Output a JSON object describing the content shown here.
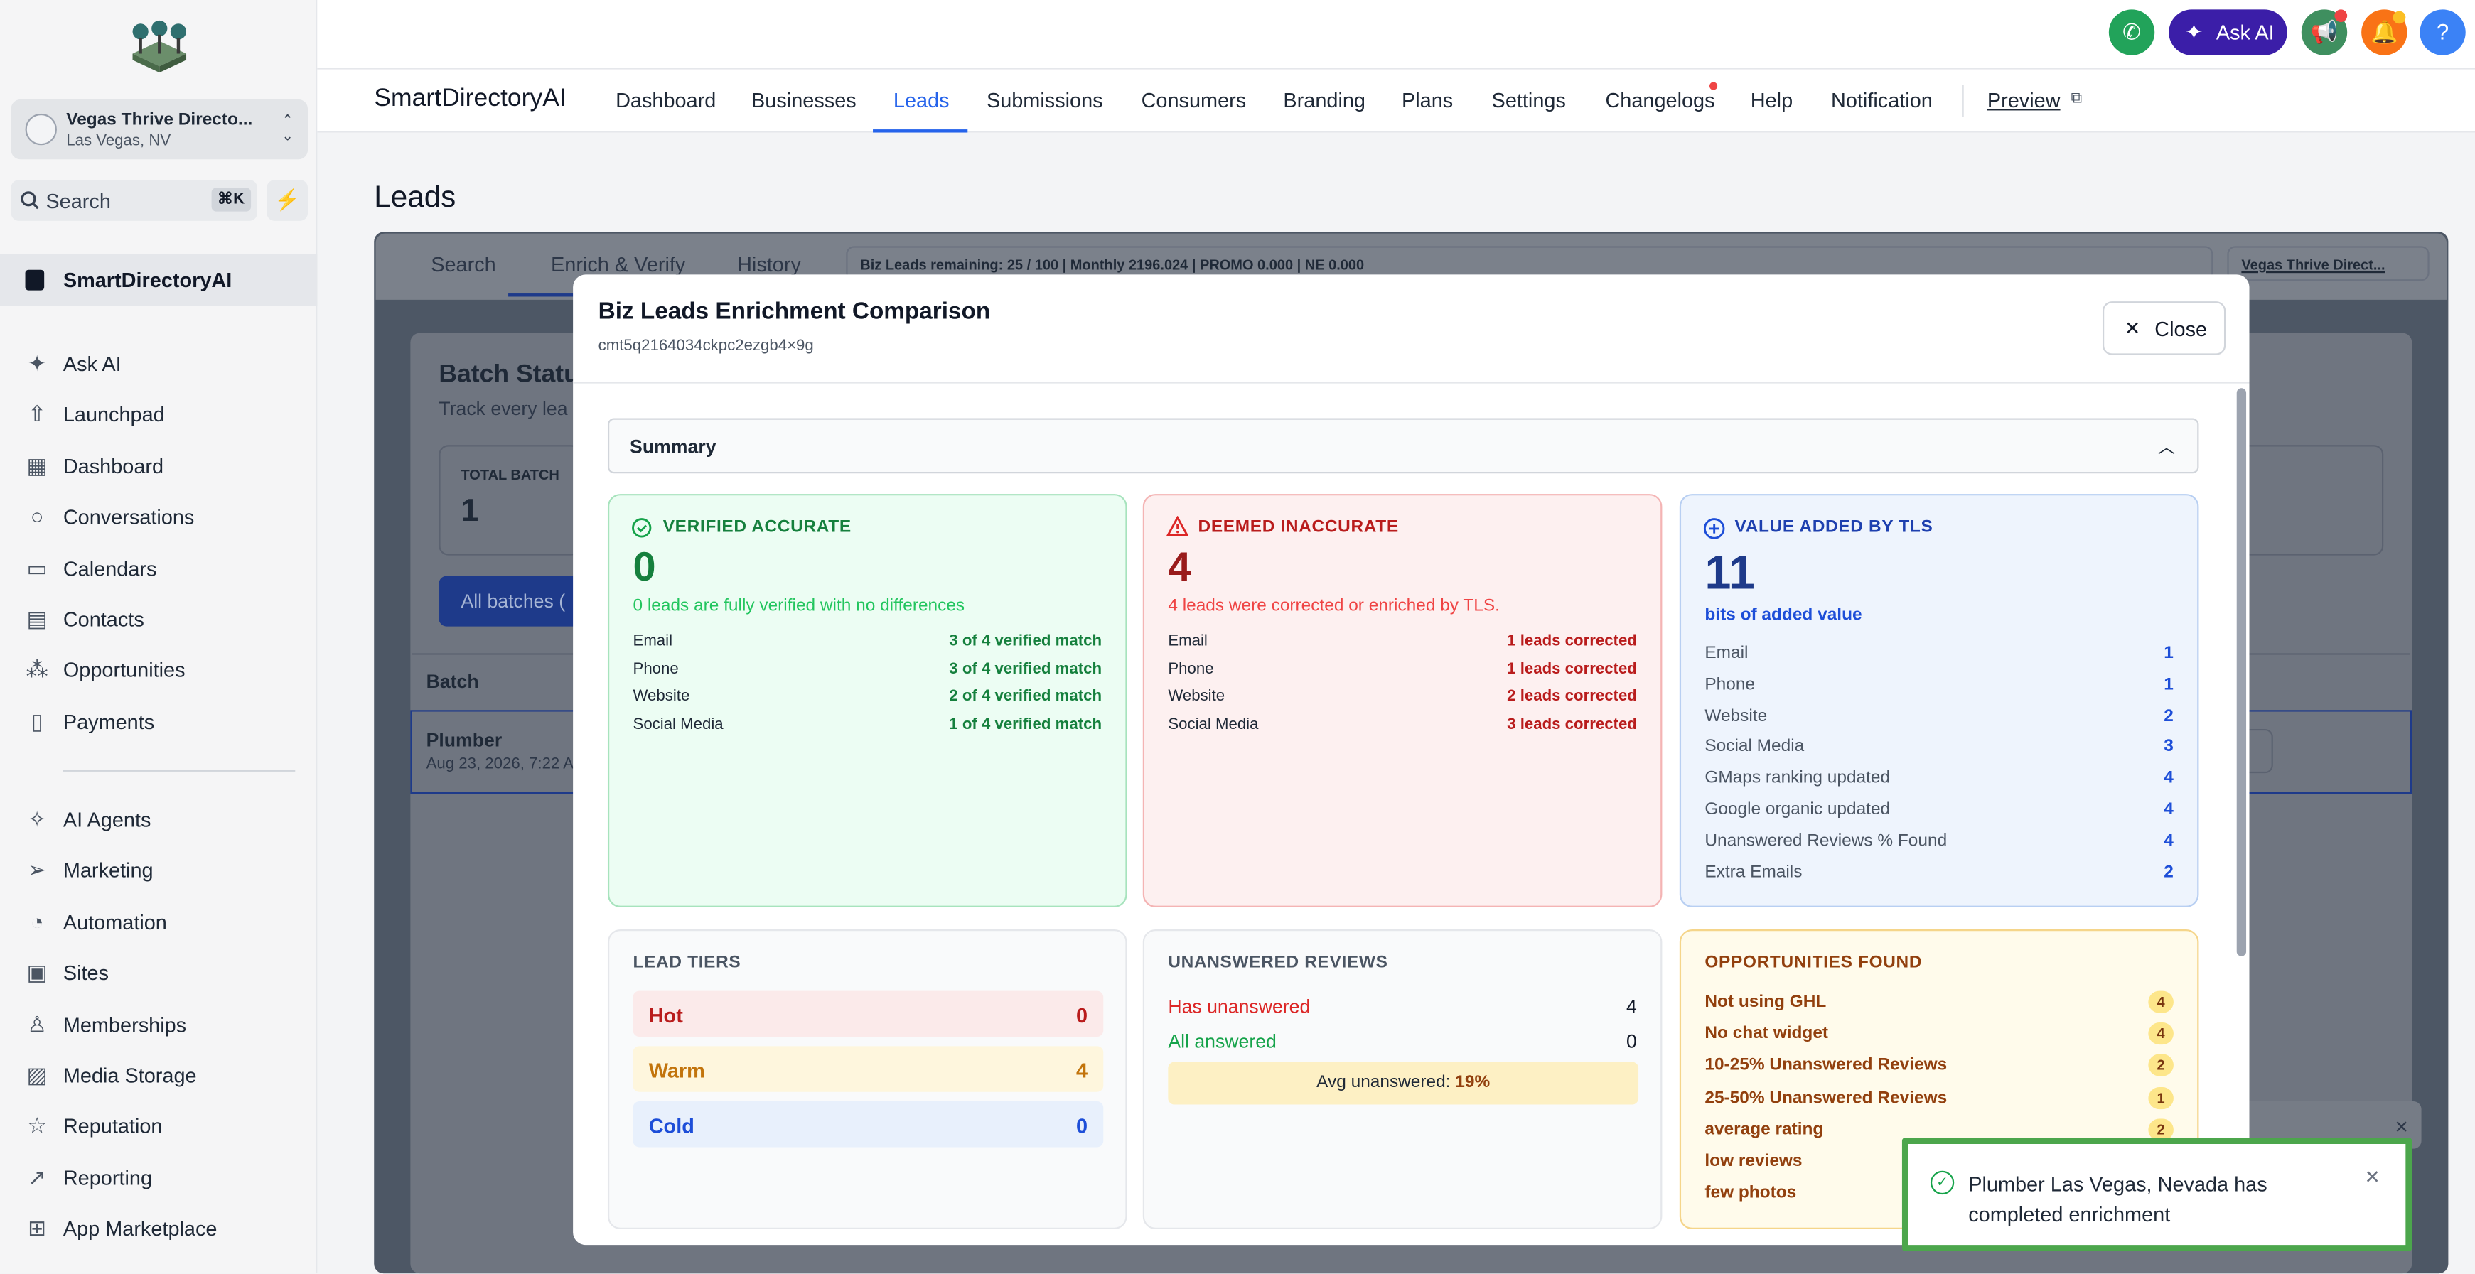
{
  "sidebar": {
    "location_name": "Vegas Thrive Directo...",
    "location_city": "Las Vegas, NV",
    "search_label": "Search",
    "search_shortcut": "⌘K",
    "selected": "SmartDirectoryAI",
    "items": [
      {
        "label": "Ask AI",
        "icon": "sparkle-icon"
      },
      {
        "label": "Launchpad",
        "icon": "rocket-icon"
      },
      {
        "label": "Dashboard",
        "icon": "grid-icon"
      },
      {
        "label": "Conversations",
        "icon": "chat-icon"
      },
      {
        "label": "Calendars",
        "icon": "calendar-icon"
      },
      {
        "label": "Contacts",
        "icon": "contacts-icon"
      },
      {
        "label": "Opportunities",
        "icon": "opportunities-icon"
      },
      {
        "label": "Payments",
        "icon": "payments-icon"
      }
    ],
    "items2": [
      {
        "label": "AI Agents",
        "icon": "ai-agents-icon"
      },
      {
        "label": "Marketing",
        "icon": "send-icon"
      },
      {
        "label": "Automation",
        "icon": "automation-icon"
      },
      {
        "label": "Sites",
        "icon": "sites-icon"
      },
      {
        "label": "Memberships",
        "icon": "memberships-icon"
      },
      {
        "label": "Media Storage",
        "icon": "image-icon"
      },
      {
        "label": "Reputation",
        "icon": "star-icon"
      },
      {
        "label": "Reporting",
        "icon": "chart-line-icon"
      },
      {
        "label": "App Marketplace",
        "icon": "apps-icon"
      }
    ]
  },
  "topbar": {
    "ask_ai": "Ask AI",
    "help": "?"
  },
  "nav": {
    "brand": "SmartDirectoryAI",
    "tabs": [
      "Dashboard",
      "Businesses",
      "Leads",
      "Submissions",
      "Consumers",
      "Branding",
      "Plans",
      "Settings",
      "Changelogs",
      "Help",
      "Notification",
      "Preview"
    ],
    "active": "Leads"
  },
  "page": {
    "title": "Leads"
  },
  "panel": {
    "tabs": [
      "Search",
      "Enrich & Verify",
      "History"
    ],
    "info": "Biz Leads remaining: 25 / 100 | Monthly 2196.024 | PROMO 0.000 | NE 0.000",
    "location": "Vegas Thrive Direct..."
  },
  "modal": {
    "title": "Biz Leads Enrichment Comparison",
    "id": "cmt5q2164034ckpc2ezgb4×9g",
    "close": "Close",
    "summary": "Summary",
    "verified": {
      "heading": "VERIFIED ACCURATE",
      "value": "0",
      "sub": "0 leads are fully verified with no differences",
      "rows": [
        {
          "label": "Email",
          "value": "3 of 4 verified match"
        },
        {
          "label": "Phone",
          "value": "3 of 4 verified match"
        },
        {
          "label": "Website",
          "value": "2 of 4 verified match"
        },
        {
          "label": "Social Media",
          "value": "1 of 4 verified match"
        }
      ]
    },
    "inaccurate": {
      "heading": "DEEMED INACCURATE",
      "value": "4",
      "sub": "4 leads were corrected or enriched by TLS.",
      "rows": [
        {
          "label": "Email",
          "value": "1 leads corrected"
        },
        {
          "label": "Phone",
          "value": "1 leads corrected"
        },
        {
          "label": "Website",
          "value": "2 leads corrected"
        },
        {
          "label": "Social Media",
          "value": "3 leads corrected"
        }
      ]
    },
    "value_added": {
      "heading": "VALUE ADDED BY TLS",
      "value": "11",
      "sub": "bits of added value",
      "rows": [
        {
          "label": "Email",
          "value": "1"
        },
        {
          "label": "Phone",
          "value": "1"
        },
        {
          "label": "Website",
          "value": "2"
        },
        {
          "label": "Social Media",
          "value": "3"
        },
        {
          "label": "GMaps ranking updated",
          "value": "4"
        },
        {
          "label": "Google organic updated",
          "value": "4"
        },
        {
          "label": "Unanswered Reviews % Found",
          "value": "4"
        },
        {
          "label": "Extra Emails",
          "value": "2"
        }
      ]
    },
    "tiers": {
      "heading": "LEAD TIERS",
      "rows": [
        {
          "label": "Hot",
          "value": "0"
        },
        {
          "label": "Warm",
          "value": "4"
        },
        {
          "label": "Cold",
          "value": "0"
        }
      ]
    },
    "unanswered": {
      "heading": "UNANSWERED REVIEWS",
      "has_label": "Has unanswered",
      "has_value": "4",
      "all_label": "All answered",
      "all_value": "0",
      "avg_label": "Avg unanswered:",
      "avg_value": "19%"
    },
    "opportunities": {
      "heading": "OPPORTUNITIES FOUND",
      "rows": [
        {
          "label": "Not using GHL",
          "value": "4"
        },
        {
          "label": "No chat widget",
          "value": "4"
        },
        {
          "label": "10-25% Unanswered Reviews",
          "value": "2"
        },
        {
          "label": "25-50% Unanswered Reviews",
          "value": "1"
        },
        {
          "label": "average rating",
          "value": "2"
        },
        {
          "label": "low reviews",
          "value": ""
        },
        {
          "label": "few photos",
          "value": ""
        }
      ]
    }
  },
  "background": {
    "batch_title": "Batch Statu",
    "batch_sub": "Track every lea",
    "total_label": "TOTAL BATCH",
    "total_value": "1",
    "all_batches": "All batches (",
    "col_batch": "Batch",
    "row_name": "Plumber",
    "row_date": "Aug 23, 2026, 7:22 A"
  },
  "toast": {
    "text": "Plumber Las Vegas, Nevada has completed enrichment"
  },
  "colors": {
    "accent": "#2563eb",
    "ask_ai": "#3b1ea8",
    "green": "#16a34a",
    "red": "#dc2626",
    "blue": "#1d4ed8"
  }
}
